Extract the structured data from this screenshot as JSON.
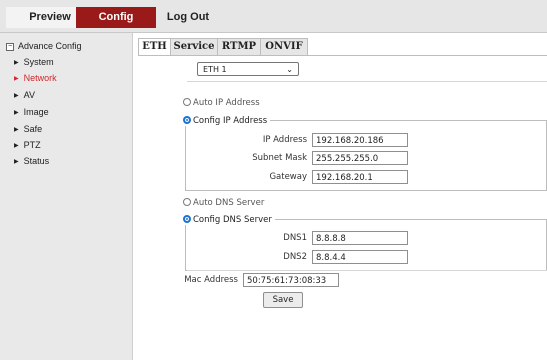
{
  "topnav": {
    "preview": "Preview",
    "config": "Config",
    "logout": "Log Out"
  },
  "sidebar": {
    "root": "Advance Config",
    "items": [
      "System",
      "Network",
      "AV",
      "Image",
      "Safe",
      "PTZ",
      "Status"
    ],
    "active": "Network"
  },
  "tabs": [
    "ETH",
    "Service",
    "RTMP",
    "ONVIF"
  ],
  "interface": {
    "selected": "ETH 1"
  },
  "ip": {
    "auto_label": "Auto IP Address",
    "config_label": "Config IP Address",
    "ip_label": "IP Address",
    "ip_value": "192.168.20.186",
    "mask_label": "Subnet Mask",
    "mask_value": "255.255.255.0",
    "gateway_label": "Gateway",
    "gateway_value": "192.168.20.1"
  },
  "dns": {
    "auto_label": "Auto DNS Server",
    "config_label": "Config DNS Server",
    "dns1_label": "DNS1",
    "dns1_value": "8.8.8.8",
    "dns2_label": "DNS2",
    "dns2_value": "8.8.4.4"
  },
  "mac": {
    "label": "Mac Address",
    "value": "50:75:61:73:08:33"
  },
  "save_label": "Save",
  "colors": {
    "accent": "#9a1a1a",
    "active_link": "#d0282d",
    "radio": "#1e73d6"
  }
}
